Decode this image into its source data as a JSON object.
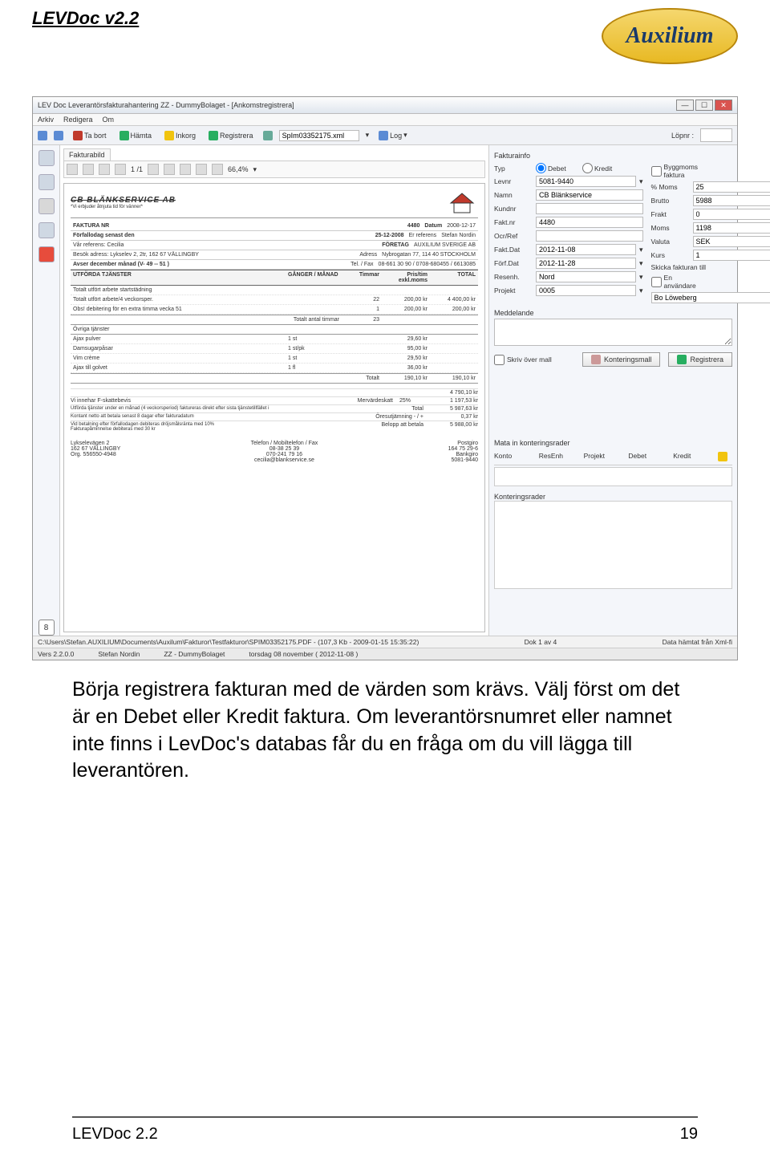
{
  "page": {
    "header_title": "LEVDoc v2.2",
    "logo_text": "Auxilium",
    "footer_left": "LEVDoc 2.2",
    "footer_right": "19",
    "body_text": "Börja registrera fakturan med de värden som krävs. Välj först om det är en Debet eller Kredit faktura. Om leverantörsnumret eller namnet inte finns i LevDoc's databas får du en fråga om du vill lägga till leverantören."
  },
  "window": {
    "title": "LEV Doc  Leverantörsfakturahantering  ZZ - DummyBolaget - [Ankomstregistrera]",
    "menu": [
      "Arkiv",
      "Redigera",
      "Om"
    ],
    "toolbar": {
      "tabort": "Ta bort",
      "hamta": "Hämta",
      "inkorg": "Inkorg",
      "registrera": "Registrera",
      "filename": "SpIm03352175.xml",
      "log": "Log",
      "lopnr_label": "Löpnr :"
    },
    "preview": {
      "tab": "Fakturabild",
      "page_indicator": "1   /1",
      "zoom": "66,4%"
    },
    "invoice": {
      "company_stamp": "CB BLÄNKSERVICE AB",
      "slogan": "*Vi erbjuder åtnjuta tid för vänner*",
      "faktura_nr_label": "FAKTURA NR",
      "faktura_nr": "4480",
      "datum_label": "Datum",
      "datum": "2008-12-17",
      "forfall_label": "Förfallodag senast den",
      "forfall": "25-12-2008",
      "erref_label": "Er referens",
      "erref": "Stefan Nordin",
      "varref_label": "Vår referens: Cecilia",
      "foretag_label": "FÖRETAG",
      "foretag": "AUXILIUM SVERIGE AB",
      "besok_label": "Besök adress: Lykselev 2, 2tr, 162 67 VÄLLINGBY",
      "adress_label": "Adress",
      "adress": "Nybrogatan 77, 114 40  STOCKHOLM",
      "avser_label": "Avser december månad     (V- 49 -- 51 )",
      "telfax_label": "Tel. / Fax",
      "telfax": "08-661 30 90 / 0708-680455 / 6613085",
      "sec_head": {
        "utforda": "UTFÖRDA TJÄNSTER",
        "ganger": "GÅNGER / MÅNAD",
        "timmar": "Timmar",
        "pris": "Pris/tim exkl.moms",
        "total": "TOTAL"
      },
      "lines": [
        {
          "desc": "Totalt utfört arbete startstädning",
          "qty": "",
          "tim": "",
          "pris": "",
          "tot": ""
        },
        {
          "desc": "Totalt utfört arbete/4 veckorsper.",
          "qty": "",
          "tim": "22",
          "pris": "200,00 kr",
          "tot": "4 400,00 kr"
        },
        {
          "desc": "Obs! debitering för en extra timma vecka 51",
          "qty": "",
          "tim": "1",
          "pris": "200,00 kr",
          "tot": "200,00 kr"
        }
      ],
      "totalt_antal_timmar_label": "Totalt antal timmar",
      "totalt_antal_timmar": "23",
      "ovriga_label": "Övriga tjänster",
      "ovriga": [
        {
          "desc": "Ajax pulver",
          "qty": "1 st",
          "pris": "29,60 kr"
        },
        {
          "desc": "Damsugarpåsar",
          "qty": "1 st/pk",
          "pris": "95,00 kr"
        },
        {
          "desc": "Vim crème",
          "qty": "1 st",
          "pris": "29,50 kr"
        },
        {
          "desc": "Ajax till golvet",
          "qty": "1 fl",
          "pris": "36,00 kr"
        }
      ],
      "totalt_label": "Totalt",
      "ovriga_sum_a": "190,10 kr",
      "ovriga_sum_b": "190,10 kr",
      "subtotal": "4 790,10 kr",
      "fskatt": "Vi innehar F-skattebevis",
      "mervarde_label": "Mervärdeskatt",
      "mervarde_pct": "25%",
      "mervarde": "1 197,53 kr",
      "period_note": "Utförda tjänster under en månad (4 veckorsperiod) faktureras direkt efter sista tjänstetillfället i",
      "total_label": "Total",
      "total": "5 987,63 kr",
      "netto_note": "Kontant netto att betala senast 8 dagar efter fakturadatum",
      "ores_label": "Öresutjämning - / +",
      "ores": "0,37 kr",
      "ranta_note": "Vid betalning efter förfallodagen debiteras dröjsmålsränta med 10%",
      "pam_note": "Fakturapåminnelse debiteras med 30 kr",
      "belopp_label": "Belopp att betala",
      "belopp": "5 988,00 kr",
      "foot_addr1": "Lykselevägen 2",
      "foot_addr2": "162 67  VÄLLINGBY",
      "foot_org": "Org. 556550-4948",
      "foot_tel_label": "Telefon / Mobiltelefon / Fax",
      "foot_tel1": "08-38 25 39",
      "foot_tel2": "070-241 79 16",
      "foot_email": "cecilia@blankservice.se",
      "foot_postgiro_label": "Postgiro",
      "foot_postgiro": "164 75 29-6",
      "foot_bankgiro_label": "Bankgiro",
      "foot_bankgiro": "5081-9440"
    },
    "info": {
      "header": "Fakturainfo",
      "typ_label": "Typ",
      "debet": "Debet",
      "kredit": "Kredit",
      "byggmoms": "Byggmoms faktura",
      "levnr_label": "Levnr",
      "levnr": "5081-9440",
      "pmoms_label": "% Moms",
      "pmoms": "25",
      "namn_label": "Namn",
      "namn": "CB Blänkservice",
      "brutto_label": "Brutto",
      "brutto": "5988",
      "kundnr_label": "Kundnr",
      "frakt_label": "Frakt",
      "frakt": "0",
      "faktnr_label": "Fakt.nr",
      "faktnr": "4480",
      "moms_label": "Moms",
      "moms": "1198",
      "ocr_label": "Ocr/Ref",
      "valuta_label": "Valuta",
      "valuta": "SEK",
      "faktdat_label": "Fakt.Dat",
      "faktdat": "2012-11-08",
      "kurs_label": "Kurs",
      "kurs": "1",
      "forfdat_label": "Förf.Dat",
      "forfdat": "2012-11-28",
      "skicka_label": "Skicka fakturan till",
      "resenh_label": "Resenh.",
      "resenh": "Nord",
      "enanv": "En användare",
      "projekt_label": "Projekt",
      "projekt": "0005",
      "attestant": "Bo Löweberg",
      "meddel_label": "Meddelande",
      "skriv": "Skriv över mall",
      "kmall_btn": "Konteringsmall",
      "reg_btn": "Registrera",
      "mata_label": "Mata in konteringsrader",
      "cols": {
        "konto": "Konto",
        "resenh": "ResEnh",
        "projekt": "Projekt",
        "debet": "Debet",
        "kredit": "Kredit"
      },
      "kont_label": "Konteringsrader"
    },
    "status1": {
      "path": "C:\\Users\\Stefan.AUXILIUM\\Documents\\Auxilum\\Fakturor\\Testfakturor\\SPIM03352175.PDF - (107,3 Kb - 2009-01-15 15:35:22)",
      "dok": "Dok 1 av 4",
      "right": "Data hämtat från Xml-fi"
    },
    "status2": {
      "vers": "Vers 2.2.0.0",
      "user": "Stefan Nordin",
      "bolag": "ZZ - DummyBolaget",
      "date": "torsdag 08 november ( 2012-11-08 )"
    }
  }
}
